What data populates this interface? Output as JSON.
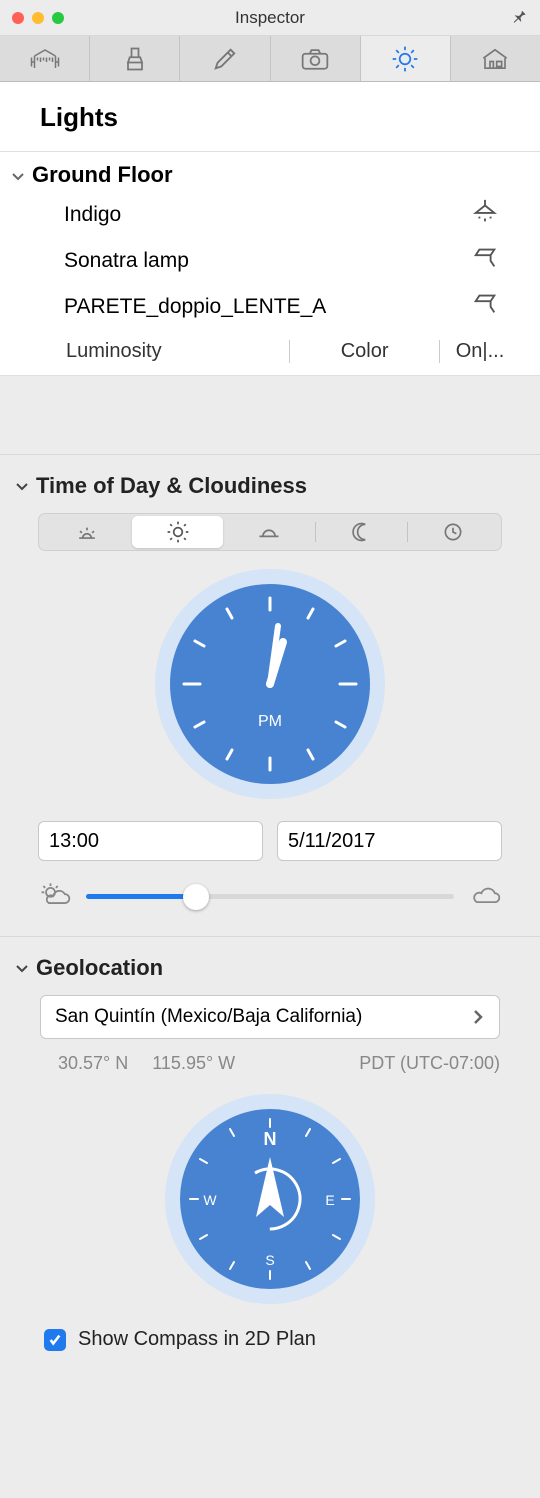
{
  "window": {
    "title": "Inspector"
  },
  "section": {
    "title": "Lights"
  },
  "lights": {
    "group_name": "Ground Floor",
    "items": [
      {
        "name": "Indigo"
      },
      {
        "name": "Sonatra lamp"
      },
      {
        "name": "PARETE_doppio_LENTE_A"
      }
    ],
    "columns": {
      "luminosity": "Luminosity",
      "color": "Color",
      "on": "On|..."
    }
  },
  "time_panel": {
    "title": "Time of Day & Cloudiness",
    "clock_label": "PM",
    "time_value": "13:00",
    "date_value": "5/11/2017",
    "cloud_percent": 30
  },
  "geo_panel": {
    "title": "Geolocation",
    "location": "San Quintín (Mexico/Baja California)",
    "lat": "30.57° N",
    "lon": "115.95° W",
    "tz": "PDT (UTC-07:00)",
    "compass_n": "N",
    "compass_e": "E",
    "compass_s": "S",
    "compass_w": "W",
    "show_compass_label": "Show Compass in 2D Plan"
  }
}
